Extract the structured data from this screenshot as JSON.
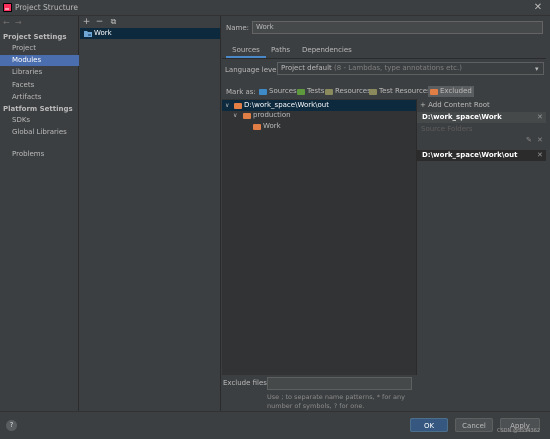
{
  "window": {
    "title": "Project Structure",
    "close_glyph": "✕"
  },
  "nav": {
    "back": "←",
    "forward": "→"
  },
  "sidebar": {
    "project_settings_heading": "Project Settings",
    "project_items": [
      {
        "label": "Project"
      },
      {
        "label": "Modules",
        "selected": true
      },
      {
        "label": "Libraries"
      },
      {
        "label": "Facets"
      },
      {
        "label": "Artifacts"
      }
    ],
    "platform_settings_heading": "Platform Settings",
    "platform_items": [
      {
        "label": "SDKs"
      },
      {
        "label": "Global Libraries"
      }
    ],
    "problems_label": "Problems"
  },
  "module_panel": {
    "toolbar": {
      "add": "+",
      "remove": "−",
      "copy": "⧉"
    },
    "modules": [
      {
        "label": "Work"
      }
    ]
  },
  "module": {
    "name_label": "Name:",
    "name_value": "Work",
    "tabs": [
      {
        "label": "Sources",
        "active": true
      },
      {
        "label": "Paths"
      },
      {
        "label": "Dependencies"
      }
    ],
    "language_level_label": "Language level:",
    "language_level_value": "Project default",
    "language_level_hint": "(8 - Lambdas, type annotations etc.)",
    "mark_as_label": "Mark as:",
    "mark_buttons": [
      {
        "label": "Sources",
        "color": "#3d8ac7"
      },
      {
        "label": "Tests",
        "color": "#5e9a3d"
      },
      {
        "label": "Resources",
        "color": "#8a8a5c"
      },
      {
        "label": "Test Resources",
        "color": "#8a8a5c"
      },
      {
        "label": "Excluded",
        "color": "#e07e46"
      }
    ],
    "tree": {
      "root": "D:\\work_space\\Work\\out",
      "child": "production",
      "grandchild": "Work"
    },
    "content_root": {
      "add_label": "Add Content Root",
      "path": "D:\\work_space\\Work",
      "source_folders_label": "Source Folders",
      "excluded_path": "D:\\work_space\\Work\\out"
    },
    "exclude_files_label": "Exclude files:",
    "exclude_files_value": "",
    "exclude_hint": "Use ; to separate name patterns, * for any number of symbols, ? for one."
  },
  "footer": {
    "help_label": "?",
    "ok_label": "OK",
    "cancel_label": "Cancel",
    "apply_label": "Apply"
  },
  "watermark": "CSDN @SSS4362"
}
